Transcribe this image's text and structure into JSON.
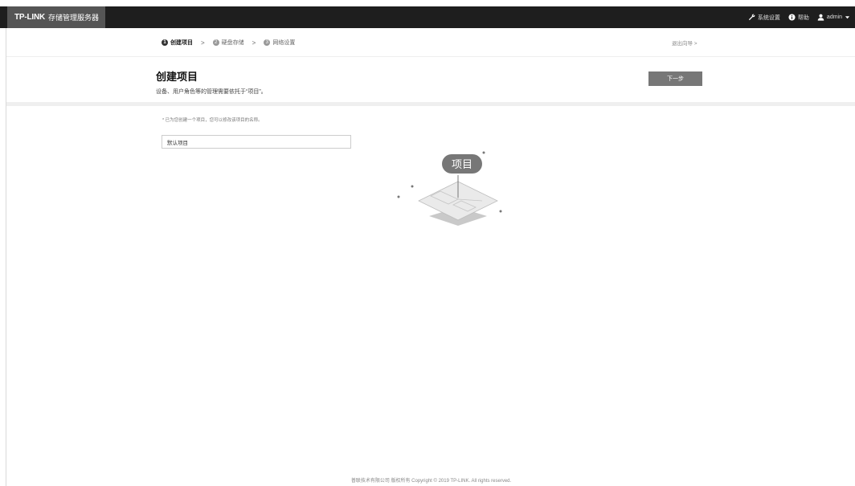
{
  "topbar": {
    "logo": "TP-LINK",
    "product": "存储管理服务器",
    "settings": "系统设置",
    "help": "帮助",
    "user": "admin"
  },
  "steps": [
    {
      "num": "1",
      "label": "创建项目"
    },
    {
      "num": "2",
      "label": "硬盘存储"
    },
    {
      "num": "3",
      "label": "网络设置"
    }
  ],
  "step_separator": ">",
  "exit_wizard": "退出向导 >",
  "page": {
    "title": "创建项目",
    "subtitle": "设备、用户角色等的管理需要依托于“项目”。",
    "next_button": "下一步"
  },
  "form": {
    "hint": "* 已为您创建一个项目，您可以修改该项目的名称。",
    "project_name_value": "默认项目"
  },
  "illustration": {
    "badge": "项目"
  },
  "footer": "普联技术有限公司 版权所有 Copyright © 2019 TP-LINK. All rights reserved."
}
